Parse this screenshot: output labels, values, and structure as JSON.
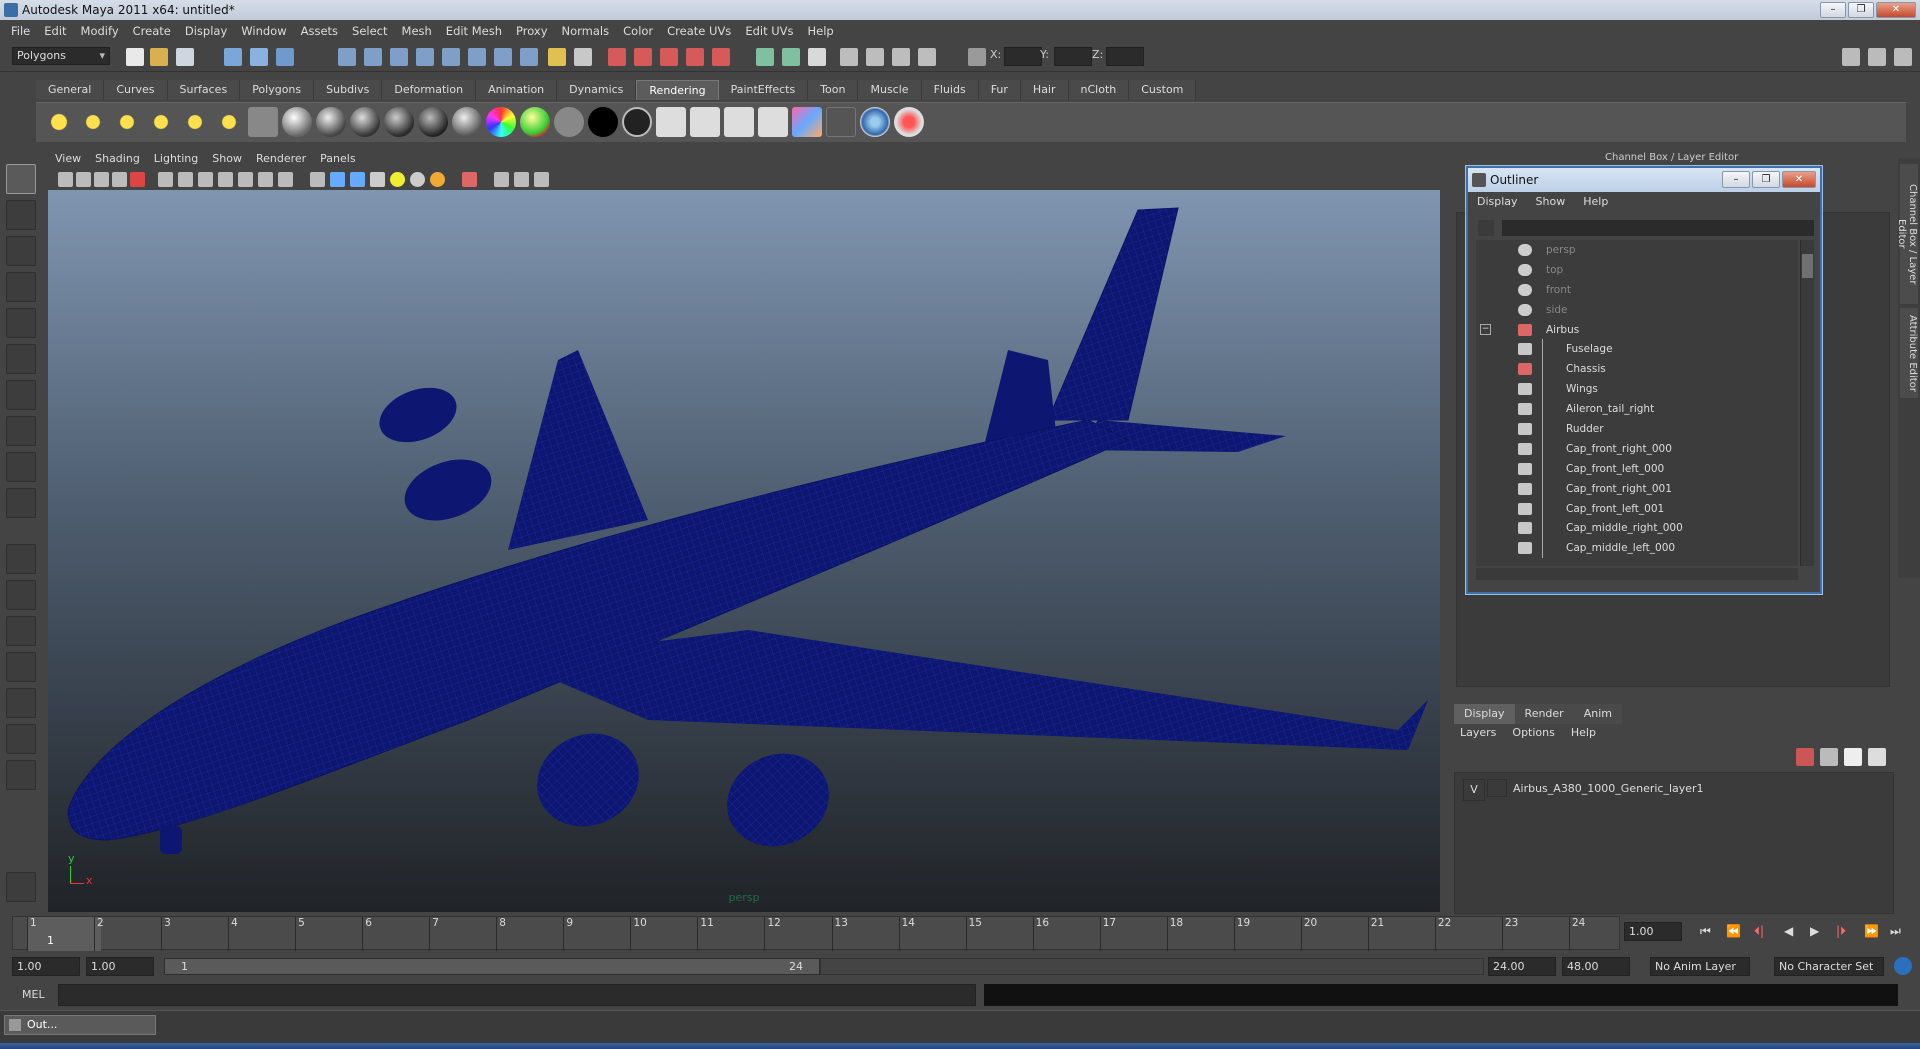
{
  "window": {
    "title": "Autodesk Maya 2011 x64: untitled*",
    "min": "–",
    "max": "❐",
    "close": "✕"
  },
  "menubar": [
    "File",
    "Edit",
    "Modify",
    "Create",
    "Display",
    "Window",
    "Assets",
    "Select",
    "Mesh",
    "Edit Mesh",
    "Proxy",
    "Normals",
    "Color",
    "Create UVs",
    "Edit UVs",
    "Help"
  ],
  "statusline": {
    "mode": "Polygons",
    "x_label": "X:",
    "y_label": "Y:",
    "z_label": "Z:"
  },
  "shelf_tabs": [
    "General",
    "Curves",
    "Surfaces",
    "Polygons",
    "Subdivs",
    "Deformation",
    "Animation",
    "Dynamics",
    "Rendering",
    "PaintEffects",
    "Toon",
    "Muscle",
    "Fluids",
    "Fur",
    "Hair",
    "nCloth",
    "Custom"
  ],
  "shelf_active": "Rendering",
  "viewport": {
    "menu": [
      "View",
      "Shading",
      "Lighting",
      "Show",
      "Renderer",
      "Panels"
    ],
    "camera_label": "persp",
    "axis_x": "x",
    "axis_y": "y",
    "wire_color": "#0d1772"
  },
  "outliner": {
    "title": "Outliner",
    "menu": [
      "Display",
      "Show",
      "Help"
    ],
    "items": [
      {
        "label": "persp",
        "type": "camera",
        "indent": 0,
        "dim": true
      },
      {
        "label": "top",
        "type": "camera",
        "indent": 0,
        "dim": true
      },
      {
        "label": "front",
        "type": "camera",
        "indent": 0,
        "dim": true
      },
      {
        "label": "side",
        "type": "camera",
        "indent": 0,
        "dim": true
      },
      {
        "label": "Airbus",
        "type": "group",
        "indent": 0,
        "dim": false,
        "expander": "−"
      },
      {
        "label": "Fuselage",
        "type": "mesh",
        "indent": 1,
        "dim": false
      },
      {
        "label": "Chassis",
        "type": "group",
        "indent": 1,
        "dim": false
      },
      {
        "label": "Wings",
        "type": "mesh",
        "indent": 1,
        "dim": false
      },
      {
        "label": "Aileron_tail_right",
        "type": "mesh",
        "indent": 1,
        "dim": false
      },
      {
        "label": "Rudder",
        "type": "mesh",
        "indent": 1,
        "dim": false
      },
      {
        "label": "Cap_front_right_000",
        "type": "mesh",
        "indent": 1,
        "dim": false
      },
      {
        "label": "Cap_front_left_000",
        "type": "mesh",
        "indent": 1,
        "dim": false
      },
      {
        "label": "Cap_front_right_001",
        "type": "mesh",
        "indent": 1,
        "dim": false
      },
      {
        "label": "Cap_front_left_001",
        "type": "mesh",
        "indent": 1,
        "dim": false
      },
      {
        "label": "Cap_middle_right_000",
        "type": "mesh",
        "indent": 1,
        "dim": false
      },
      {
        "label": "Cap_middle_left_000",
        "type": "mesh",
        "indent": 1,
        "dim": false
      }
    ]
  },
  "channel_box": {
    "title": "Channel Box / Layer Editor"
  },
  "side_tabs": [
    "Channel Box / Layer Editor",
    "Attribute Editor"
  ],
  "layer_editor": {
    "tabs": [
      "Display",
      "Render",
      "Anim"
    ],
    "active_tab": "Display",
    "menu": [
      "Layers",
      "Options",
      "Help"
    ],
    "layers": [
      {
        "visible": "V",
        "name": "Airbus_A380_1000_Generic_layer1"
      }
    ]
  },
  "timeline": {
    "frames": [
      "1",
      "2",
      "3",
      "4",
      "5",
      "6",
      "7",
      "8",
      "9",
      "10",
      "11",
      "12",
      "13",
      "14",
      "15",
      "16",
      "17",
      "18",
      "19",
      "20",
      "21",
      "22",
      "23",
      "24"
    ],
    "current_frame": "1",
    "current_time_field": "1.00"
  },
  "range": {
    "start_time": "1.00",
    "playback_start": "1.00",
    "range_start_label": "1",
    "range_end_label": "24",
    "playback_end": "24.00",
    "end_time": "48.00",
    "anim_layer": "No Anim Layer",
    "character_set": "No Character Set"
  },
  "playback_controls": [
    "⏮",
    "⏪",
    "⏴|",
    "◀",
    "▶",
    "|⏵",
    "⏩",
    "⏭"
  ],
  "command_line": {
    "label": "MEL"
  },
  "taskbar": {
    "item": "Out..."
  }
}
